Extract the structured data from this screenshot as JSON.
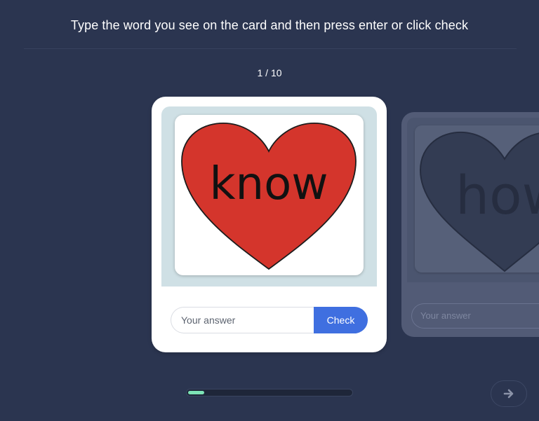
{
  "header": {
    "instruction": "Type the word you see on the card and then press enter or click check",
    "counter": "1 / 10"
  },
  "current_card": {
    "word": "know",
    "answer_placeholder": "Your answer",
    "check_label": "Check"
  },
  "next_card": {
    "word": "how",
    "answer_placeholder": "Your answer"
  },
  "progress": {
    "current": 1,
    "total": 10,
    "fraction": 0.1
  },
  "icons": {
    "next_button": "arrow-right-icon"
  },
  "colors": {
    "background": "#2b3550",
    "heart": "#d4352c",
    "check_button": "#3f6fe0",
    "progress_fill": "#7de3b6"
  }
}
